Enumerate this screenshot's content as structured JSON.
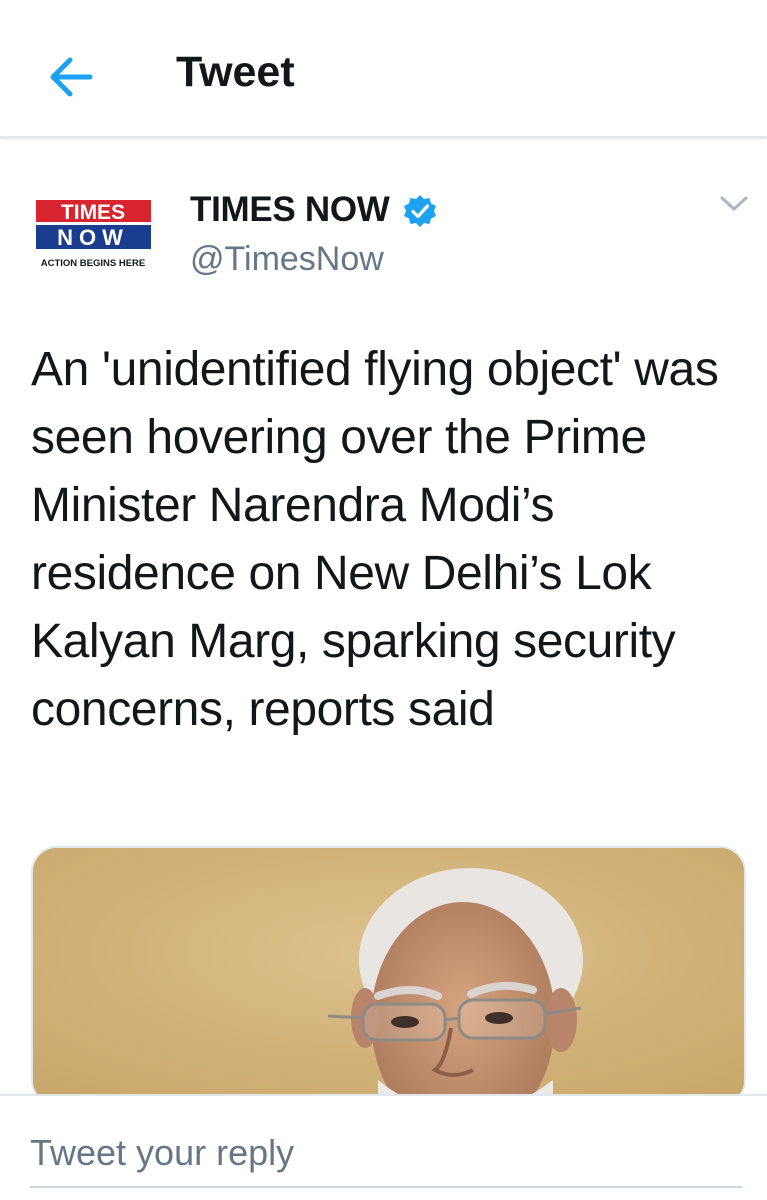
{
  "header": {
    "title": "Tweet",
    "back_icon": "arrow-left-icon"
  },
  "author": {
    "name": "TIMES NOW",
    "handle": "@TimesNow",
    "verified": true,
    "logo": {
      "line1": "TIMES",
      "line2": "NOW",
      "tagline": "ACTION BEGINS HERE"
    }
  },
  "tweet": {
    "text": "An 'unidentified flying object' was seen hovering over the Prime Minister Narendra Modi’s residence on New Delhi’s Lok Kalyan Marg, sparking security concerns, reports said"
  },
  "reply": {
    "placeholder": "Tweet your reply"
  },
  "colors": {
    "accent": "#1da1f2",
    "text": "#14171a",
    "secondary": "#657786",
    "logo_red": "#d7242f",
    "logo_blue": "#1a3d8f"
  }
}
